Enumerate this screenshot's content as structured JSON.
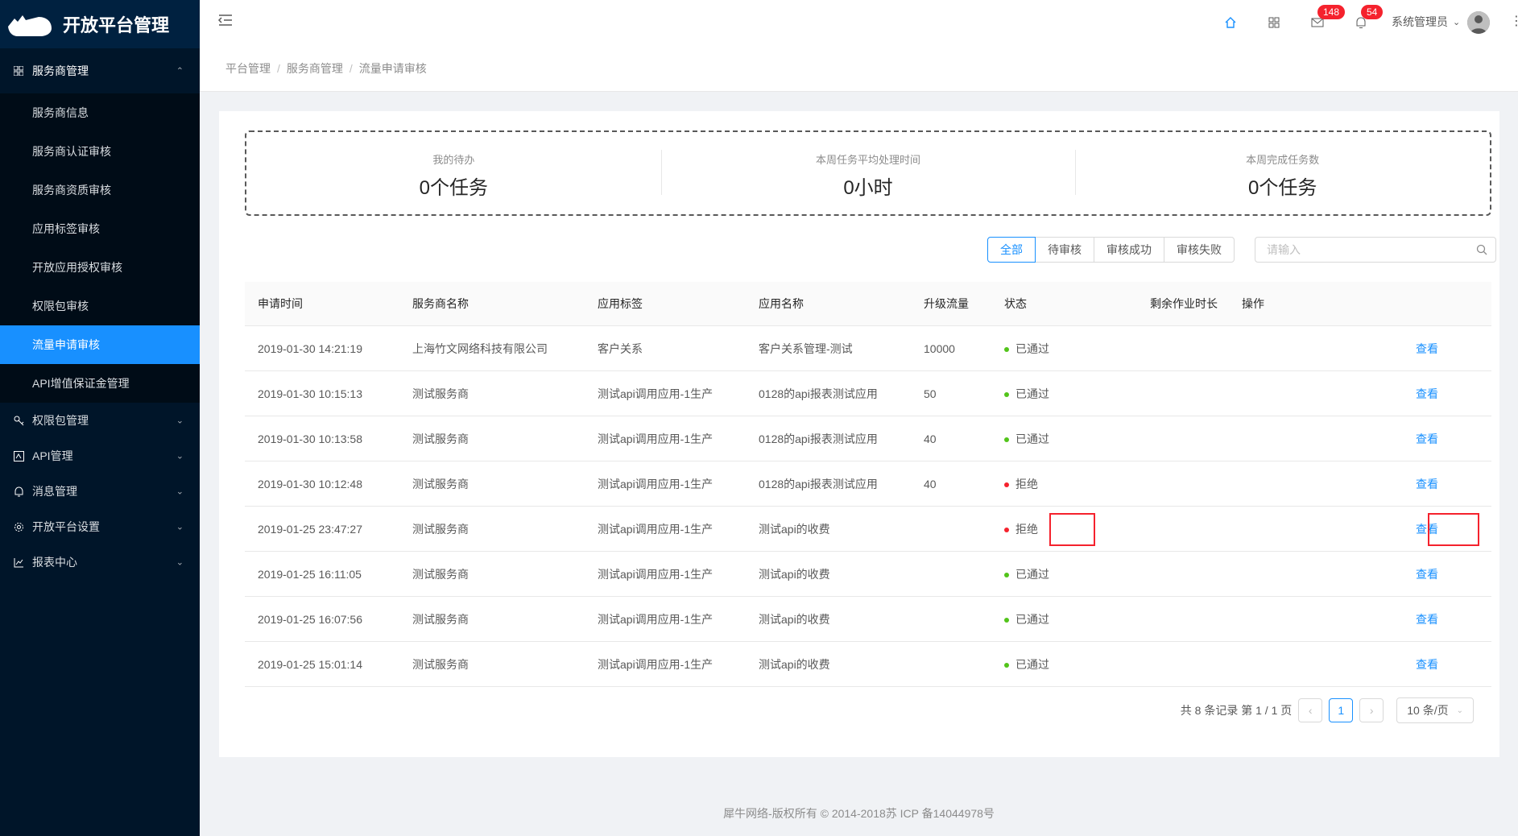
{
  "app": {
    "title": "开放平台管理"
  },
  "sidebar": {
    "group_main": {
      "label": "服务商管理"
    },
    "sub_items": [
      {
        "label": "服务商信息"
      },
      {
        "label": "服务商认证审核"
      },
      {
        "label": "服务商资质审核"
      },
      {
        "label": "应用标签审核"
      },
      {
        "label": "开放应用授权审核"
      },
      {
        "label": "权限包审核"
      },
      {
        "label": "流量申请审核"
      },
      {
        "label": "API增值保证金管理"
      }
    ],
    "groups": [
      {
        "label": "权限包管理",
        "icon": "key-icon"
      },
      {
        "label": "API管理",
        "icon": "api-icon"
      },
      {
        "label": "消息管理",
        "icon": "bell-icon"
      },
      {
        "label": "开放平台设置",
        "icon": "gear-icon"
      },
      {
        "label": "报表中心",
        "icon": "chart-icon"
      }
    ]
  },
  "header": {
    "mail_badge": "148",
    "bell_badge": "54",
    "user_name": "系统管理员"
  },
  "breadcrumb": [
    "平台管理",
    "服务商管理",
    "流量申请审核"
  ],
  "stats": [
    {
      "label": "我的待办",
      "value": "0个任务"
    },
    {
      "label": "本周任务平均处理时间",
      "value": "0小时"
    },
    {
      "label": "本周完成任务数",
      "value": "0个任务"
    }
  ],
  "filters": [
    "全部",
    "待审核",
    "审核成功",
    "审核失败"
  ],
  "search": {
    "placeholder": "请输入"
  },
  "table": {
    "columns": [
      "申请时间",
      "服务商名称",
      "应用标签",
      "应用名称",
      "升级流量",
      "状态",
      "剩余作业时长",
      "操作"
    ],
    "rows": [
      {
        "time": "2019-01-30 14:21:19",
        "provider": "上海竹文网络科技有限公司",
        "tag": "客户关系",
        "app": "客户关系管理-测试",
        "flow": "10000",
        "status": "已通过",
        "status_type": "ok",
        "remain": "",
        "action": "查看"
      },
      {
        "time": "2019-01-30 10:15:13",
        "provider": "测试服务商",
        "tag": "测试api调用应用-1生产",
        "app": "0128的api报表测试应用",
        "flow": "50",
        "status": "已通过",
        "status_type": "ok",
        "remain": "",
        "action": "查看"
      },
      {
        "time": "2019-01-30 10:13:58",
        "provider": "测试服务商",
        "tag": "测试api调用应用-1生产",
        "app": "0128的api报表测试应用",
        "flow": "40",
        "status": "已通过",
        "status_type": "ok",
        "remain": "",
        "action": "查看"
      },
      {
        "time": "2019-01-30 10:12:48",
        "provider": "测试服务商",
        "tag": "测试api调用应用-1生产",
        "app": "0128的api报表测试应用",
        "flow": "40",
        "status": "拒绝",
        "status_type": "no",
        "remain": "",
        "action": "查看"
      },
      {
        "time": "2019-01-25 23:47:27",
        "provider": "测试服务商",
        "tag": "测试api调用应用-1生产",
        "app": "测试api的收费",
        "flow": "",
        "status": "拒绝",
        "status_type": "no",
        "remain": "",
        "action": "查看"
      },
      {
        "time": "2019-01-25 16:11:05",
        "provider": "测试服务商",
        "tag": "测试api调用应用-1生产",
        "app": "测试api的收费",
        "flow": "",
        "status": "已通过",
        "status_type": "ok",
        "remain": "",
        "action": "查看"
      },
      {
        "time": "2019-01-25 16:07:56",
        "provider": "测试服务商",
        "tag": "测试api调用应用-1生产",
        "app": "测试api的收费",
        "flow": "",
        "status": "已通过",
        "status_type": "ok",
        "remain": "",
        "action": "查看"
      },
      {
        "time": "2019-01-25 15:01:14",
        "provider": "测试服务商",
        "tag": "测试api调用应用-1生产",
        "app": "测试api的收费",
        "flow": "",
        "status": "已通过",
        "status_type": "ok",
        "remain": "",
        "action": "查看"
      }
    ]
  },
  "pagination": {
    "summary": "共 8 条记录 第 1 / 1 页",
    "current": "1",
    "page_size": "10 条/页"
  },
  "footer": {
    "text": "犀牛网络-版权所有 © 2014-2018苏 ICP 备14044978号"
  }
}
